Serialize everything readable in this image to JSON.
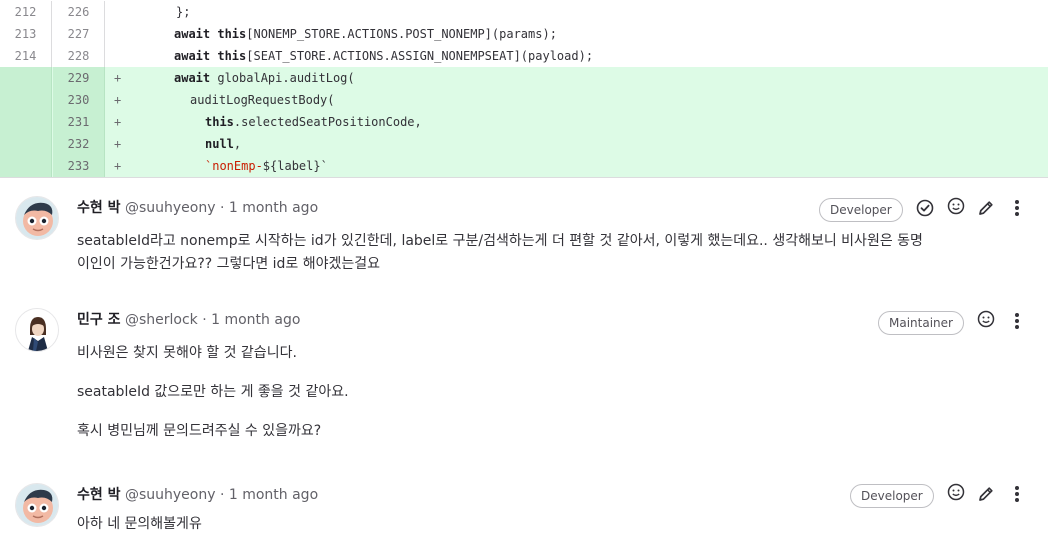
{
  "diff": {
    "lines": [
      {
        "old": "212",
        "new": "226",
        "marker": "",
        "type": "context"
      },
      {
        "old": "213",
        "new": "227",
        "marker": "",
        "type": "context"
      },
      {
        "old": "214",
        "new": "228",
        "marker": "",
        "type": "context"
      },
      {
        "old": "",
        "new": "229",
        "marker": "+",
        "type": "added"
      },
      {
        "old": "",
        "new": "230",
        "marker": "+",
        "type": "added"
      },
      {
        "old": "",
        "new": "231",
        "marker": "+",
        "type": "added"
      },
      {
        "old": "",
        "new": "232",
        "marker": "+",
        "type": "added"
      },
      {
        "old": "",
        "new": "233",
        "marker": "+",
        "type": "added"
      }
    ],
    "code": {
      "l226": "};",
      "l227_kw1": "await",
      "l227_kw2": "this",
      "l227_rest": "[NONEMP_STORE.ACTIONS.POST_NONEMP](params);",
      "l228_kw1": "await",
      "l228_kw2": "this",
      "l228_rest": "[SEAT_STORE.ACTIONS.ASSIGN_NONEMPSEAT](payload);",
      "l229_kw": "await",
      "l229_rest": "globalApi.auditLog(",
      "l230": "auditLogRequestBody(",
      "l231_kw": "this",
      "l231_rest": ".selectedSeatPositionCode,",
      "l232_kw": "null",
      "l232_rest": ",",
      "l233_str": "`nonEmp-",
      "l233_rest": "${label}`"
    }
  },
  "notes": [
    {
      "name": "수현 박",
      "meta": "@suuhyeony · 1 month ago",
      "role": "Developer",
      "body": [
        "seatableId라고 nonemp로 시작하는 id가 있긴한데, label로 구분/검색하는게 더 편할 것 같아서, 이렇게 했는데요.. 생각해보니 비사원은 동명",
        "이인이 가능한건가요?? 그렇다면 id로 해야겠는걸요"
      ]
    },
    {
      "name": "민구 조",
      "meta": "@sherlock · 1 month ago",
      "role": "Maintainer",
      "body": [
        "비사원은 찾지 못해야 할 것 같습니다.",
        "seatableId 값으로만 하는 게 좋을 것 같아요.",
        "혹시 병민님께 문의드려주실 수 있을까요?"
      ]
    },
    {
      "name": "수현 박",
      "meta": "@suuhyeony · 1 month ago",
      "role": "Developer",
      "body": [
        "아하 네 문의해볼게유"
      ]
    }
  ]
}
